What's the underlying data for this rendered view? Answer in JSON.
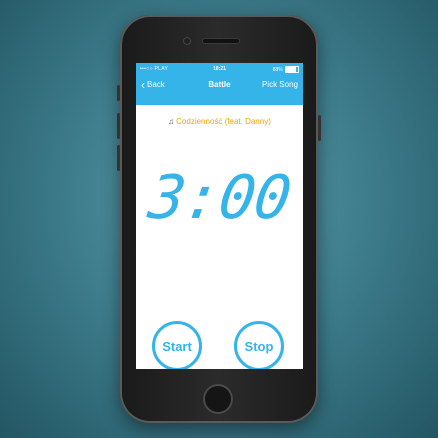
{
  "status_bar": {
    "carrier": "•••○○ PLAY",
    "time": "18:21",
    "battery_percent": "88%"
  },
  "nav": {
    "back_label": "Back",
    "title": "Battle",
    "right_label": "Pick Song"
  },
  "song": {
    "title": "Codzienność (feat. Danny)"
  },
  "timer": {
    "value": "3:00"
  },
  "controls": {
    "start_label": "Start",
    "stop_label": "Stop"
  },
  "colors": {
    "accent": "#35b4e9",
    "song_text": "#e8a800"
  }
}
